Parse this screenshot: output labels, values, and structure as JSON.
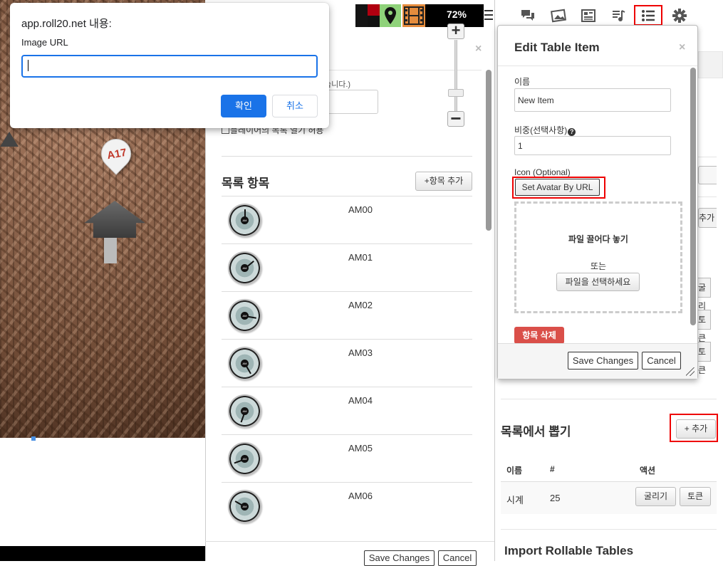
{
  "prompt": {
    "title": "app.roll20.net 내용:",
    "message": "Image URL",
    "input_value": "",
    "ok_label": "확인",
    "cancel_label": "취소"
  },
  "map": {
    "pin_label": "A17"
  },
  "toolbar": {
    "zoom": "72%",
    "zoom_in": "+",
    "zoom_out": "−",
    "colors": {
      "red": "#b00010",
      "green": "#8fd27a",
      "orange": "#e58c3d"
    },
    "icons": [
      "map-pin-icon",
      "film-icon",
      "hamburger-icon"
    ]
  },
  "table_dialog": {
    "close": "×",
    "hint": "습니다.)",
    "show_checkbox_label": "플레이어의 목록 열기 허용",
    "items_title": "목록 항목",
    "add_item_label": "+항목 추가",
    "items": [
      {
        "label": "AM00"
      },
      {
        "label": "AM01"
      },
      {
        "label": "AM02"
      },
      {
        "label": "AM03"
      },
      {
        "label": "AM04"
      },
      {
        "label": "AM05"
      },
      {
        "label": "AM06"
      }
    ],
    "icon_text": "AM",
    "save_label": "Save Changes",
    "cancel_label": "Cancel"
  },
  "sidebar": {
    "tabs": [
      "chat-icon",
      "art-library-icon",
      "journal-icon",
      "jukebox-icon",
      "rollable-tables-icon",
      "settings-icon"
    ],
    "partial_buttons": [
      "추가",
      "굴리기",
      "토큰",
      "토큰"
    ],
    "roll_from_list_title": "목록에서 뽑기",
    "add_label": "+ 추가",
    "table_headers": {
      "name": "이름",
      "count": "#",
      "action": "액션"
    },
    "rows": [
      {
        "name": "시계",
        "count": "25",
        "roll_label": "굴리기",
        "token_label": "토큰"
      }
    ],
    "import_title": "Import Rollable Tables"
  },
  "edit_dialog": {
    "title": "Edit Table Item",
    "close": "×",
    "name_label": "이름",
    "name_value": "New Item",
    "weight_label": "비중(선택사항)",
    "weight_value": "1",
    "icon_label": "Icon (Optional)",
    "avatar_url_label": "Set Avatar By URL",
    "drop_text": "파일 끌어다 놓기",
    "or_text": "또는",
    "choose_file_label": "파일을 선택하세요",
    "delete_label": "항목 삭제",
    "save_label": "Save Changes",
    "cancel_label": "Cancel"
  },
  "highlight_color": "#e00000"
}
